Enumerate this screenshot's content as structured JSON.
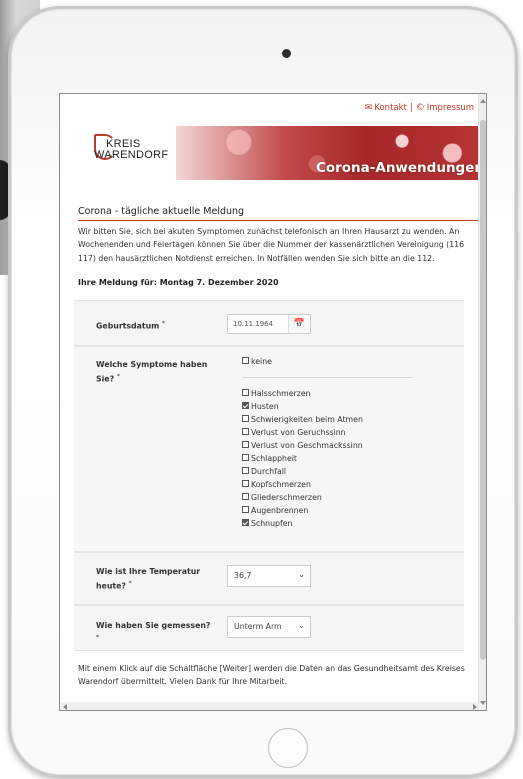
{
  "topbar": {
    "kontakt": "Kontakt",
    "separator": "|",
    "impressum": "Impressum",
    "mail_icon": "✉",
    "copyright_icon": "©"
  },
  "banner": {
    "logo_line1": "KREIS",
    "logo_line2": "WARENDORF",
    "title": "Corona-Anwendungen"
  },
  "page": {
    "section_title": "Corona - tägliche aktuelle Meldung",
    "intro": "Wir bitten Sie, sich bei akuten Symptomen zunächst telefonisch an Ihren Hausarzt zu wenden. An Wochenenden und Feiertagen können Sie über die Nummer der kassenärztlichen Vereinigung (116 117) den hausärztlichen Notdienst erreichen. In Notfällen wenden Sie sich bitte an die 112.",
    "meldung": "Ihre Meldung für: Montag 7. Dezember 2020",
    "footer": "Mit einem Klick auf die Schaltfläche [Weiter] werden die Daten an das Gesundheitsamt des Kreises Warendorf übermittelt. Vielen Dank für Ihre Mitarbeit."
  },
  "form": {
    "birthdate": {
      "label": "Geburtsdatum",
      "required": "*",
      "value": "10.11.1964",
      "calendar_icon": "📅"
    },
    "symptoms": {
      "label": "Welche Symptome haben Sie?",
      "required": "*",
      "none_option": "keine",
      "options": [
        {
          "label": "Halsschmerzen",
          "checked": false
        },
        {
          "label": "Husten",
          "checked": true
        },
        {
          "label": "Schwierigkeiten beim Atmen",
          "checked": false
        },
        {
          "label": "Verlust von Geruchssinn",
          "checked": false
        },
        {
          "label": "Verlust von Geschmackssinn",
          "checked": false
        },
        {
          "label": "Schlappheit",
          "checked": false
        },
        {
          "label": "Durchfall",
          "checked": false
        },
        {
          "label": "Kopfschmerzen",
          "checked": false
        },
        {
          "label": "Gliederschmerzen",
          "checked": false
        },
        {
          "label": "Augenbrennen",
          "checked": false
        },
        {
          "label": "Schnupfen",
          "checked": true
        }
      ]
    },
    "temperature": {
      "label": "Wie ist Ihre Temperatur heute?",
      "required": "*",
      "value": "36,7",
      "chevron": "⌄"
    },
    "method": {
      "label": "Wie haben Sie gemessen?",
      "required": "*",
      "value": "Unterm Arm",
      "chevron": "⌄"
    }
  }
}
